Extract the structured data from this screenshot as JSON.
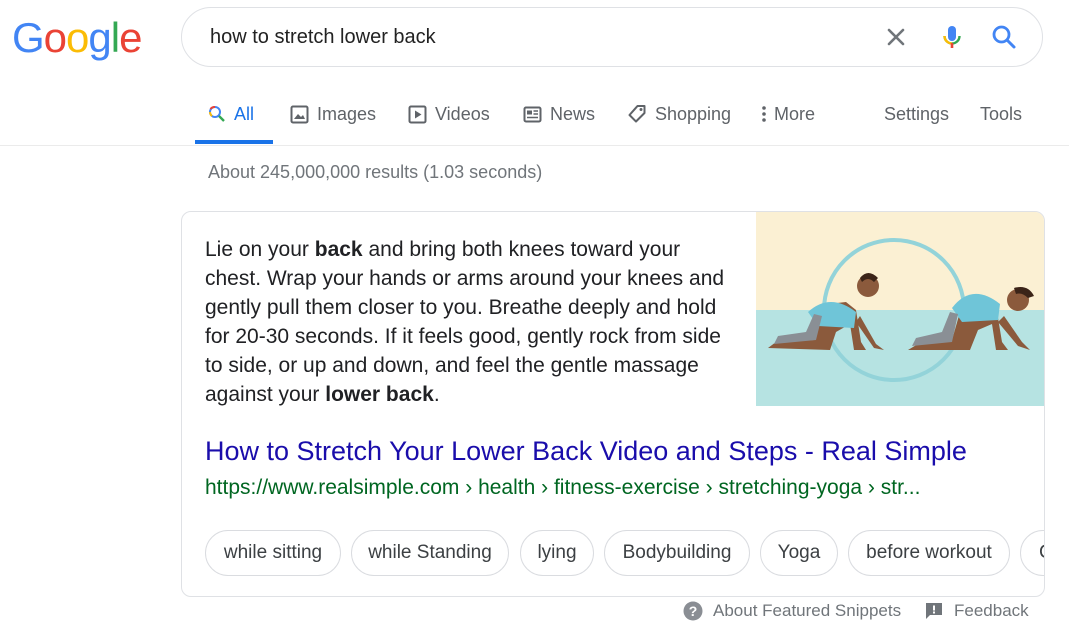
{
  "logo": {
    "letters": [
      "G",
      "o",
      "o",
      "g",
      "l",
      "e"
    ],
    "colors": [
      "#4285f4",
      "#ea4335",
      "#fbbc05",
      "#4285f4",
      "#34a853",
      "#ea4335"
    ]
  },
  "search": {
    "query": "how to stretch lower back"
  },
  "tabs": [
    {
      "label": "All",
      "icon": "search-icon"
    },
    {
      "label": "Images",
      "icon": "image-icon"
    },
    {
      "label": "Videos",
      "icon": "play-icon"
    },
    {
      "label": "News",
      "icon": "news-icon"
    },
    {
      "label": "Shopping",
      "icon": "tag-icon"
    },
    {
      "label": "More",
      "icon": "more-vert-icon"
    }
  ],
  "tools": {
    "settings": "Settings",
    "tools": "Tools"
  },
  "result_stats": "About 245,000,000 results (1.03 seconds)",
  "snippet": {
    "p1": "Lie on your ",
    "b1": "back",
    "p2": " and bring both knees toward your chest. Wrap your hands or arms around your knees and gently pull them closer to you. Breathe deeply and hold for 20-30 seconds. If it feels good, gently rock from side to side, or up and down, and feel the gentle massage against your ",
    "b2": "lower back",
    "p3": "."
  },
  "result": {
    "title": "How to Stretch Your Lower Back Video and Steps - Real Simple",
    "url": "https://www.realsimple.com › health › fitness-exercise › stretching-yoga › str..."
  },
  "chips": [
    "while sitting",
    "while Standing",
    "lying",
    "Bodybuilding",
    "Yoga",
    "before workout",
    "C"
  ],
  "footer": {
    "about": "About Featured Snippets",
    "feedback": "Feedback"
  },
  "accent": "#1a73e8",
  "link_color": "#1a0dab",
  "url_color": "#006621"
}
